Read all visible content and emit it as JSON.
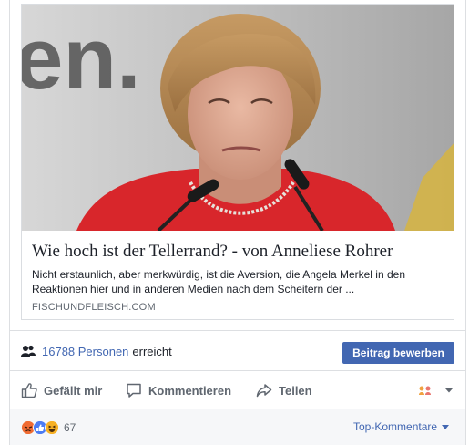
{
  "link": {
    "title": "Wie hoch ist der Tellerrand? - von Anneliese Rohrer",
    "description": "Nicht erstaunlich, aber merkwürdig, ist die Aversion, die Angela Merkel in den Reaktionen hier und in anderen Medien nach dem Scheitern der ...",
    "domain": "FISCHUNDFLEISCH.COM",
    "background_text": "en."
  },
  "reach": {
    "count": "16788 Personen",
    "suffix": "erreicht",
    "icon": "people-icon"
  },
  "boost_button": "Beitrag bewerben",
  "actions": {
    "like": "Gefällt mir",
    "comment": "Kommentieren",
    "share": "Teilen"
  },
  "reactions": {
    "types": [
      "angry",
      "like",
      "haha"
    ],
    "count": "67"
  },
  "top_comments": "Top-Kommentare",
  "colors": {
    "fb_blue": "#4267b2",
    "muted": "#606770",
    "summary_bg": "#f6f7f9",
    "blazer": "#d8262b"
  }
}
